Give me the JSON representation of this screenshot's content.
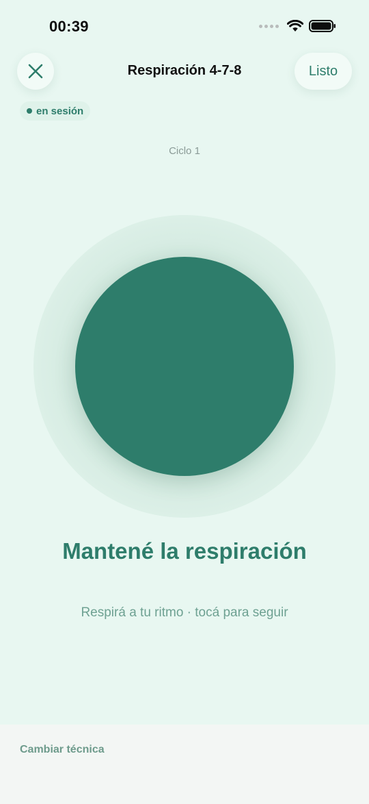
{
  "status_bar": {
    "time": "00:39"
  },
  "header": {
    "title": "Respiración 4-7-8",
    "done_label": "Listo"
  },
  "session": {
    "badge": "en sesión"
  },
  "cycle": {
    "label": "Ciclo 1"
  },
  "phase": {
    "title": "Mantené la respiración",
    "hint": "Respirá a tu ritmo · tocá para seguir"
  },
  "footer": {
    "change_technique_label": "Cambiar técnica"
  },
  "colors": {
    "background": "#e8f7f1",
    "accent": "#2e7d6b",
    "footer_background": "#f3f6f4"
  },
  "icons": [
    "signal-dots-icon",
    "wifi-icon",
    "battery-icon",
    "close-icon"
  ]
}
